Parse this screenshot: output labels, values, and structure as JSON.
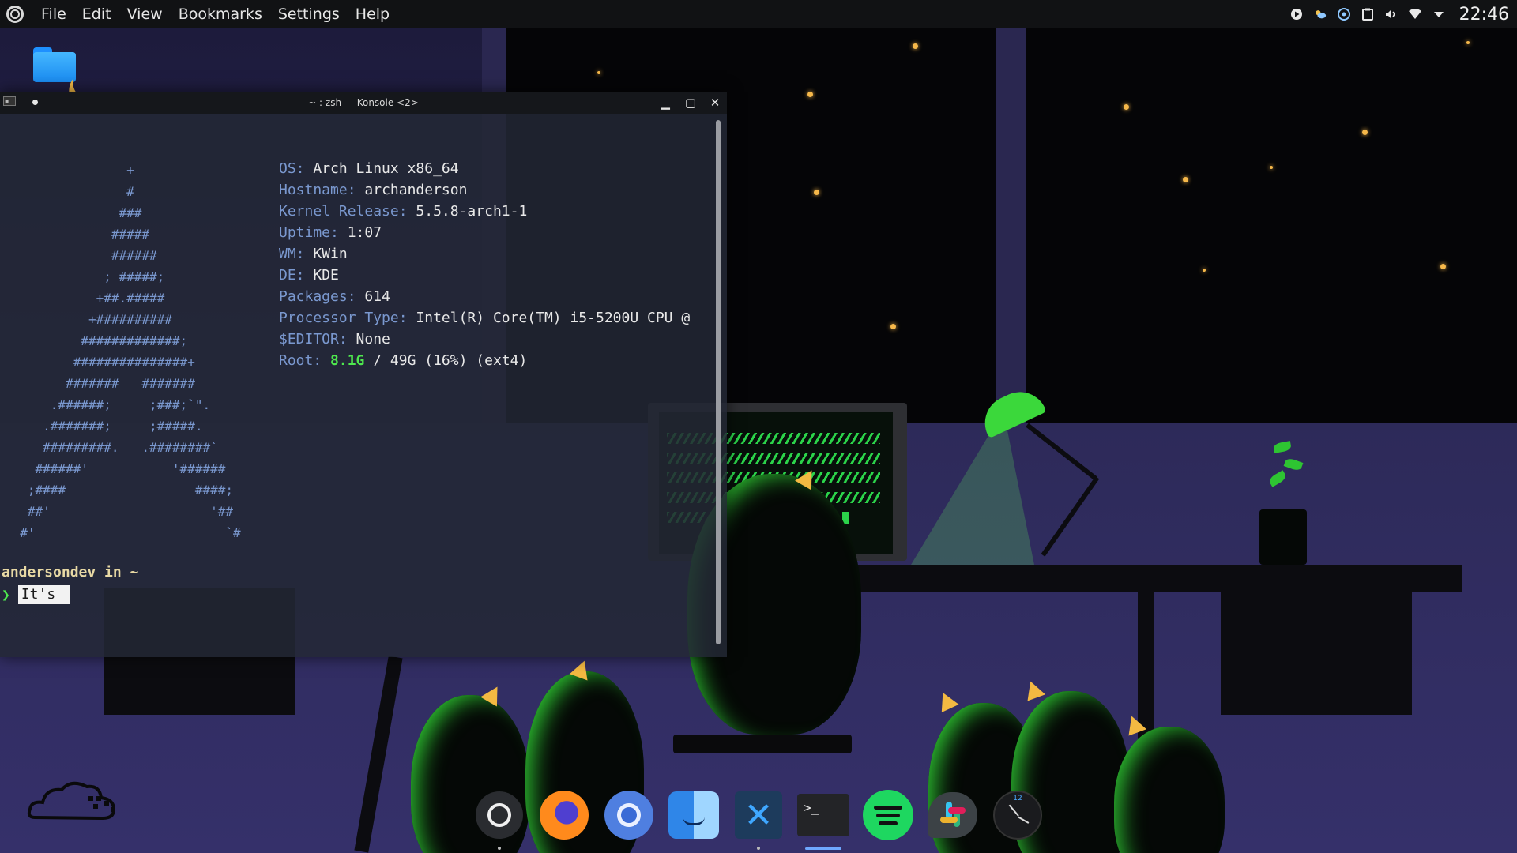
{
  "menu_bar": {
    "items": [
      "File",
      "Edit",
      "View",
      "Bookmarks",
      "Settings",
      "Help"
    ]
  },
  "tray": {
    "icons": [
      "media-play-icon",
      "weather-icon",
      "steam-icon",
      "clipboard-icon",
      "volume-icon",
      "wifi-icon",
      "expand-tray-icon"
    ],
    "clock": "22:46"
  },
  "konsole": {
    "title": "~ : zsh — Konsole <2>",
    "minimize": "▁",
    "maximize": "▢",
    "close": "✕",
    "ascii_art": "                +\n                #\n               ###\n              #####\n              ######\n             ; #####;\n            +##.#####\n           +##########\n          #############;\n         ###############+\n        #######   #######\n      .######;     ;###;`\".\n     .#######;     ;#####.\n     #########.   .########`\n    ######'           '######\n   ;####                 ####;\n   ##'                     '##\n  #'                         `#",
    "info": [
      {
        "key": "OS:",
        "value": "Arch Linux x86_64"
      },
      {
        "key": "Hostname:",
        "value": "archanderson"
      },
      {
        "key": "Kernel Release:",
        "value": "5.5.8-arch1-1"
      },
      {
        "key": "Uptime:",
        "value": "1:07"
      },
      {
        "key": "WM:",
        "value": "KWin"
      },
      {
        "key": "DE:",
        "value": "KDE"
      },
      {
        "key": "Packages:",
        "value": "614"
      },
      {
        "key": "Processor Type:",
        "value": "Intel(R) Core(TM) i5-5200U CPU @"
      },
      {
        "key": "$EDITOR:",
        "value": "None"
      }
    ],
    "root": {
      "key": "Root:",
      "used": "8.1G",
      "rest": "/ 49G (16%) (ext4)"
    },
    "prompt_user": "andersondev in ~",
    "prompt_arrow": "❯",
    "prompt_input": "It's"
  },
  "dock": {
    "apps": [
      "kde-launcher",
      "firefox",
      "chromium",
      "finder",
      "vscode",
      "terminal",
      "spotify",
      "slack",
      "clock"
    ],
    "terminal_glyph": ">_",
    "clock_label": "12"
  },
  "colors": {
    "accent_green": "#4ee84e",
    "ascii_blue": "#7a98cf",
    "star": "#f6b84a"
  }
}
